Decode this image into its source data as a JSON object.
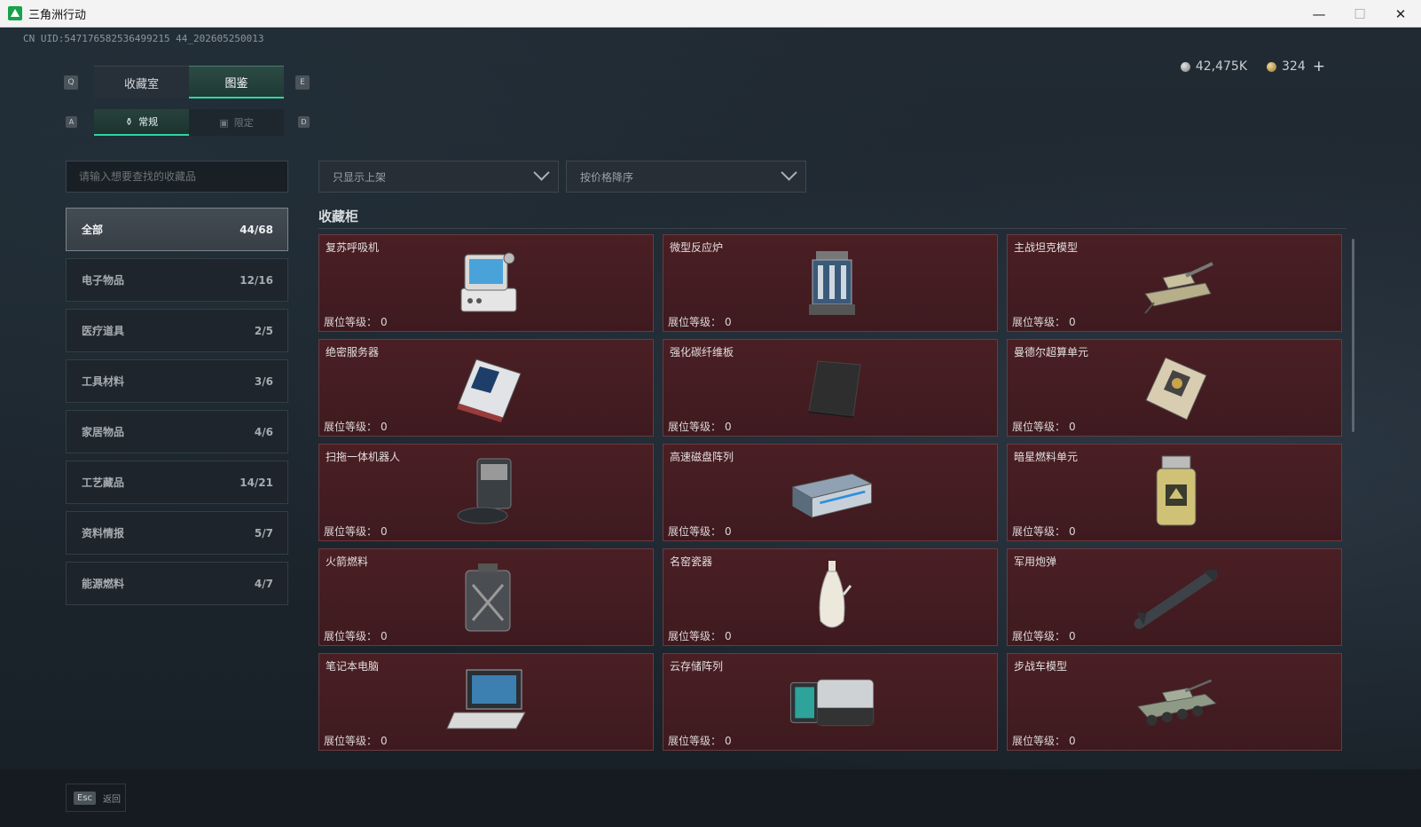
{
  "window": {
    "title": "三角洲行动",
    "minimize": "—",
    "maximize": "☐",
    "close": "✕"
  },
  "uid": "CN UID:547176582536499215 44_202605250013",
  "currency": {
    "silver": "42,475K",
    "gold": "324",
    "plus": "+"
  },
  "key_hints": {
    "q": "Q",
    "e": "E",
    "a": "A",
    "d": "D"
  },
  "tabs": {
    "main": [
      {
        "label": "收藏室"
      },
      {
        "label": "图鉴"
      }
    ],
    "sub": [
      {
        "label": "常规"
      },
      {
        "label": "限定"
      }
    ]
  },
  "search": {
    "placeholder": "请输入想要查找的收藏品"
  },
  "filters": {
    "shelf": "只显示上架",
    "sort": "按价格降序"
  },
  "categories": [
    {
      "name": "全部",
      "count": "44/68"
    },
    {
      "name": "电子物品",
      "count": "12/16"
    },
    {
      "name": "医疗道具",
      "count": "2/5"
    },
    {
      "name": "工具材料",
      "count": "3/6"
    },
    {
      "name": "家居物品",
      "count": "4/6"
    },
    {
      "name": "工艺藏品",
      "count": "14/21"
    },
    {
      "name": "资料情报",
      "count": "5/7"
    },
    {
      "name": "能源燃料",
      "count": "4/7"
    }
  ],
  "section_title": "收藏柜",
  "level_label": "展位等级：",
  "items": [
    {
      "name": "复苏呼吸机",
      "level": "0",
      "icon": "ventilator-icon"
    },
    {
      "name": "微型反应炉",
      "level": "0",
      "icon": "reactor-icon"
    },
    {
      "name": "主战坦克模型",
      "level": "0",
      "icon": "tank-model-icon"
    },
    {
      "name": "绝密服务器",
      "level": "0",
      "icon": "server-icon"
    },
    {
      "name": "强化碳纤维板",
      "level": "0",
      "icon": "carbon-plate-icon"
    },
    {
      "name": "曼德尔超算单元",
      "level": "0",
      "icon": "supercomputer-unit-icon"
    },
    {
      "name": "扫拖一体机器人",
      "level": "0",
      "icon": "robot-vacuum-icon"
    },
    {
      "name": "高速磁盘阵列",
      "level": "0",
      "icon": "disk-array-icon"
    },
    {
      "name": "暗星燃料单元",
      "level": "0",
      "icon": "fuel-cell-icon"
    },
    {
      "name": "火箭燃料",
      "level": "0",
      "icon": "fuel-can-icon"
    },
    {
      "name": "名窑瓷器",
      "level": "0",
      "icon": "porcelain-vase-icon"
    },
    {
      "name": "军用炮弹",
      "level": "0",
      "icon": "missile-icon"
    },
    {
      "name": "笔记本电脑",
      "level": "0",
      "icon": "laptop-icon"
    },
    {
      "name": "云存储阵列",
      "level": "0",
      "icon": "storage-array-icon"
    },
    {
      "name": "步战车模型",
      "level": "0",
      "icon": "ifv-model-icon"
    }
  ],
  "footer": {
    "esc_key": "Esc",
    "back_label": "返回"
  }
}
